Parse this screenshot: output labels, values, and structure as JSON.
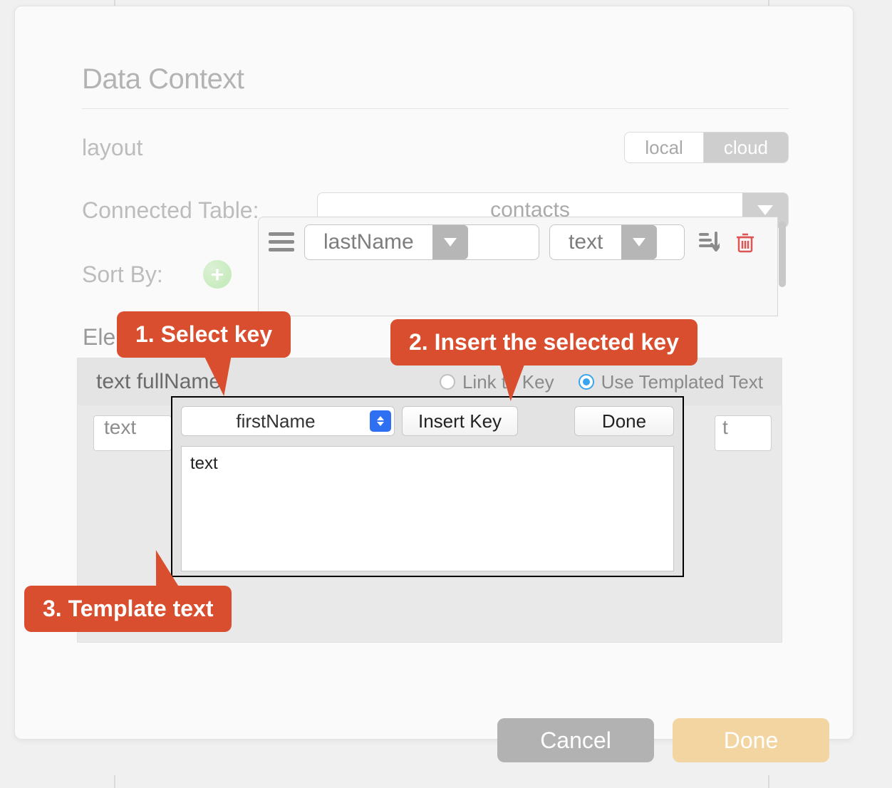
{
  "header": {
    "title": "Data Context"
  },
  "layout": {
    "label": "layout",
    "segments": {
      "local": "local",
      "cloud": "cloud"
    },
    "selected": "cloud"
  },
  "connected_table": {
    "label": "Connected Table:",
    "value": "contacts"
  },
  "sort_by": {
    "label": "Sort By:",
    "field": "lastName",
    "type": "text"
  },
  "elements": {
    "section_label_partial": "Ele",
    "row_label": "text fullName",
    "radio_link": "Link to Key",
    "radio_templated": "Use Templated Text",
    "left_input": "text",
    "right_input": "t"
  },
  "template_popup": {
    "key_select": "firstName",
    "insert_label": "Insert Key",
    "done_label": "Done",
    "textarea": "text"
  },
  "footer": {
    "cancel": "Cancel",
    "done": "Done"
  },
  "callouts": {
    "c1": "1. Select key",
    "c2": "2. Insert the selected key",
    "c3": "3. Template text"
  }
}
